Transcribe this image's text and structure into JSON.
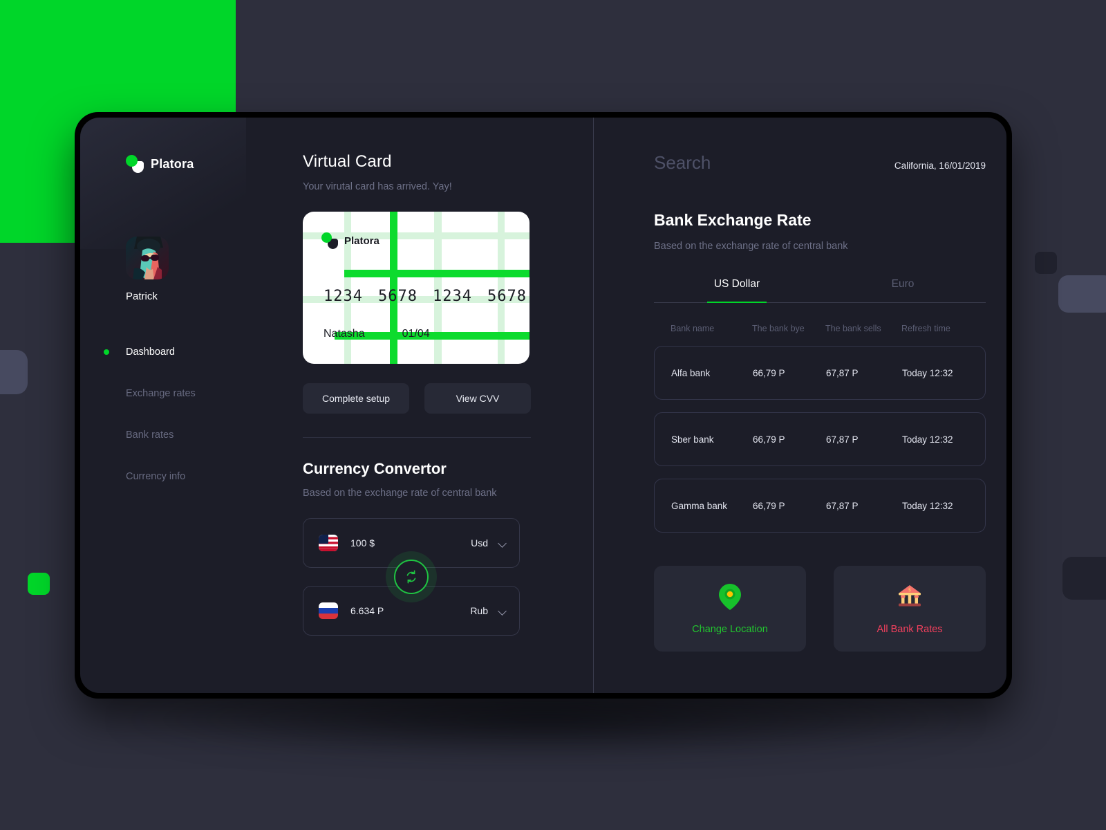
{
  "brand": {
    "name": "Platora",
    "logo_icon": "platora-logo-icon",
    "accent": "#00d629"
  },
  "sidebar": {
    "profile": {
      "name": "Patrick",
      "avatar_icon": "user-avatar"
    },
    "items": [
      {
        "label": "Dashboard",
        "active": true
      },
      {
        "label": "Exchange rates",
        "active": false
      },
      {
        "label": "Bank rates",
        "active": false
      },
      {
        "label": "Currency info",
        "active": false
      }
    ]
  },
  "virtual_card": {
    "title": "Virtual Card",
    "subtitle": "Your virutal card has arrived. Yay!",
    "card": {
      "brand": "Platora",
      "number_groups": [
        "1234",
        "5678",
        "1234",
        "5678"
      ],
      "holder": "Natasha",
      "expiry": "01/04"
    },
    "buttons": [
      {
        "label": "Complete setup"
      },
      {
        "label": "View CVV"
      }
    ]
  },
  "converter": {
    "title": "Currency Convertor",
    "subtitle": "Based on the exchange rate of central bank",
    "swap_icon": "refresh-swap-icon",
    "from": {
      "flag_icon": "flag-us-icon",
      "value": "100 $",
      "currency": "Usd",
      "chevron": "chevron-down-icon"
    },
    "to": {
      "flag_icon": "flag-ru-icon",
      "value": "6.634 P",
      "currency": "Rub",
      "chevron": "chevron-down-icon"
    }
  },
  "right": {
    "search_placeholder": "Search",
    "location_date": "California, 16/01/2019",
    "title": "Bank Exchange Rate",
    "subtitle": "Based on the exchange rate of central bank",
    "tabs": [
      {
        "label": "US Dollar",
        "active": true
      },
      {
        "label": "Euro",
        "active": false
      }
    ],
    "table": {
      "headers": [
        "Bank name",
        "The bank bye",
        "The bank sells",
        "Refresh time"
      ],
      "rows": [
        {
          "bank": "Alfa bank",
          "buy": "66,79 P",
          "sell": "67,87 P",
          "refresh": "Today 12:32"
        },
        {
          "bank": "Sber bank",
          "buy": "66,79 P",
          "sell": "67,87 P",
          "refresh": "Today 12:32"
        },
        {
          "bank": "Gamma bank",
          "buy": "66,79 P",
          "sell": "67,87 P",
          "refresh": "Today 12:32"
        }
      ]
    },
    "actions": [
      {
        "label": "Change Location",
        "color": "#22c52f",
        "icon": "map-pin-icon"
      },
      {
        "label": "All Bank Rates",
        "color": "#f2405d",
        "icon": "bank-building-icon"
      }
    ]
  }
}
